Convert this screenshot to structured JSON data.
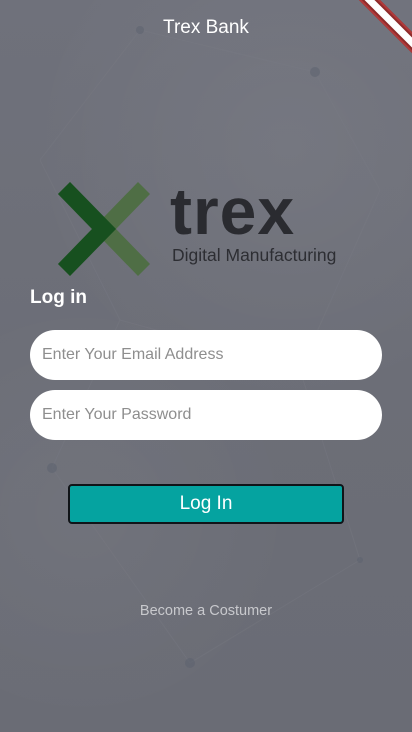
{
  "app": {
    "title": "Trex Bank"
  },
  "logo": {
    "wordmark": "trex",
    "tagline": "Digital Manufacturing",
    "colors": {
      "mark_dark": "#17501f",
      "mark_light": "#4f6e45",
      "text": "#2a2b30"
    }
  },
  "login": {
    "heading": "Log in",
    "email_placeholder": "Enter Your Email Address",
    "email_value": "",
    "password_placeholder": "Enter Your Password",
    "password_value": "",
    "submit_label": "Log In",
    "register_link": "Become a Costumer"
  },
  "theme": {
    "background": "#6d6f78",
    "button_color": "#05a3a0",
    "field_background": "#ffffff"
  }
}
